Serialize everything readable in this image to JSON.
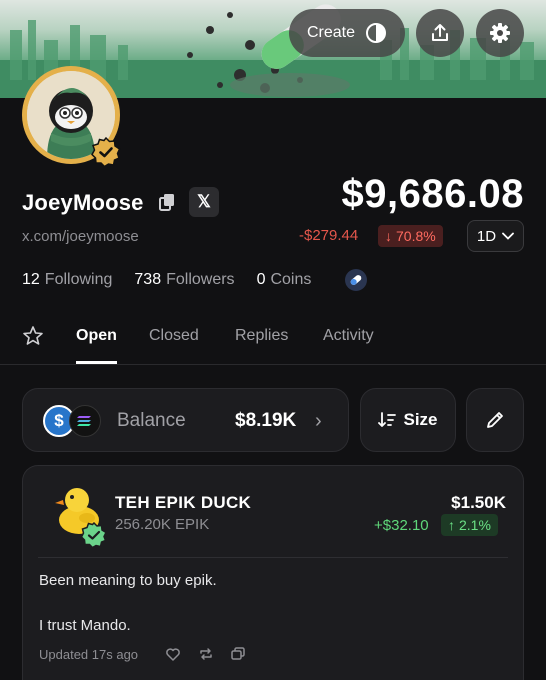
{
  "header": {
    "create_label": "Create",
    "share_icon": "share-icon",
    "settings_icon": "gear-icon"
  },
  "profile": {
    "name": "JoeyMoose",
    "x_label": "𝕏",
    "link": "x.com/joeymoose",
    "portfolio_value": "$9,686.08",
    "change_abs": "-$279.44",
    "change_pct": "70.8%",
    "period": "1D",
    "stats": {
      "following_count": "12",
      "following_label": "Following",
      "followers_count": "738",
      "followers_label": "Followers",
      "coins_count": "0",
      "coins_label": "Coins"
    }
  },
  "tabs": [
    {
      "label": "Open",
      "active": true
    },
    {
      "label": "Closed",
      "active": false
    },
    {
      "label": "Replies",
      "active": false
    },
    {
      "label": "Activity",
      "active": false
    }
  ],
  "balance": {
    "label": "Balance",
    "value": "$8.19K",
    "usdc_glyph": "$",
    "size_label": "Size"
  },
  "position": {
    "name": "TEH EPIK DUCK",
    "amount": "256.20K EPIK",
    "value": "$1.50K",
    "gain": "+$32.10",
    "gain_pct": "2.1%",
    "note_line1": "Been meaning to buy epik.",
    "note_line2": "I trust Mando.",
    "updated": "Updated 17s ago"
  },
  "colors": {
    "negative": "#e5574c",
    "positive": "#5fd77a",
    "badge_green": "#6bd38a",
    "avatar_ring": "#e4b04a"
  }
}
